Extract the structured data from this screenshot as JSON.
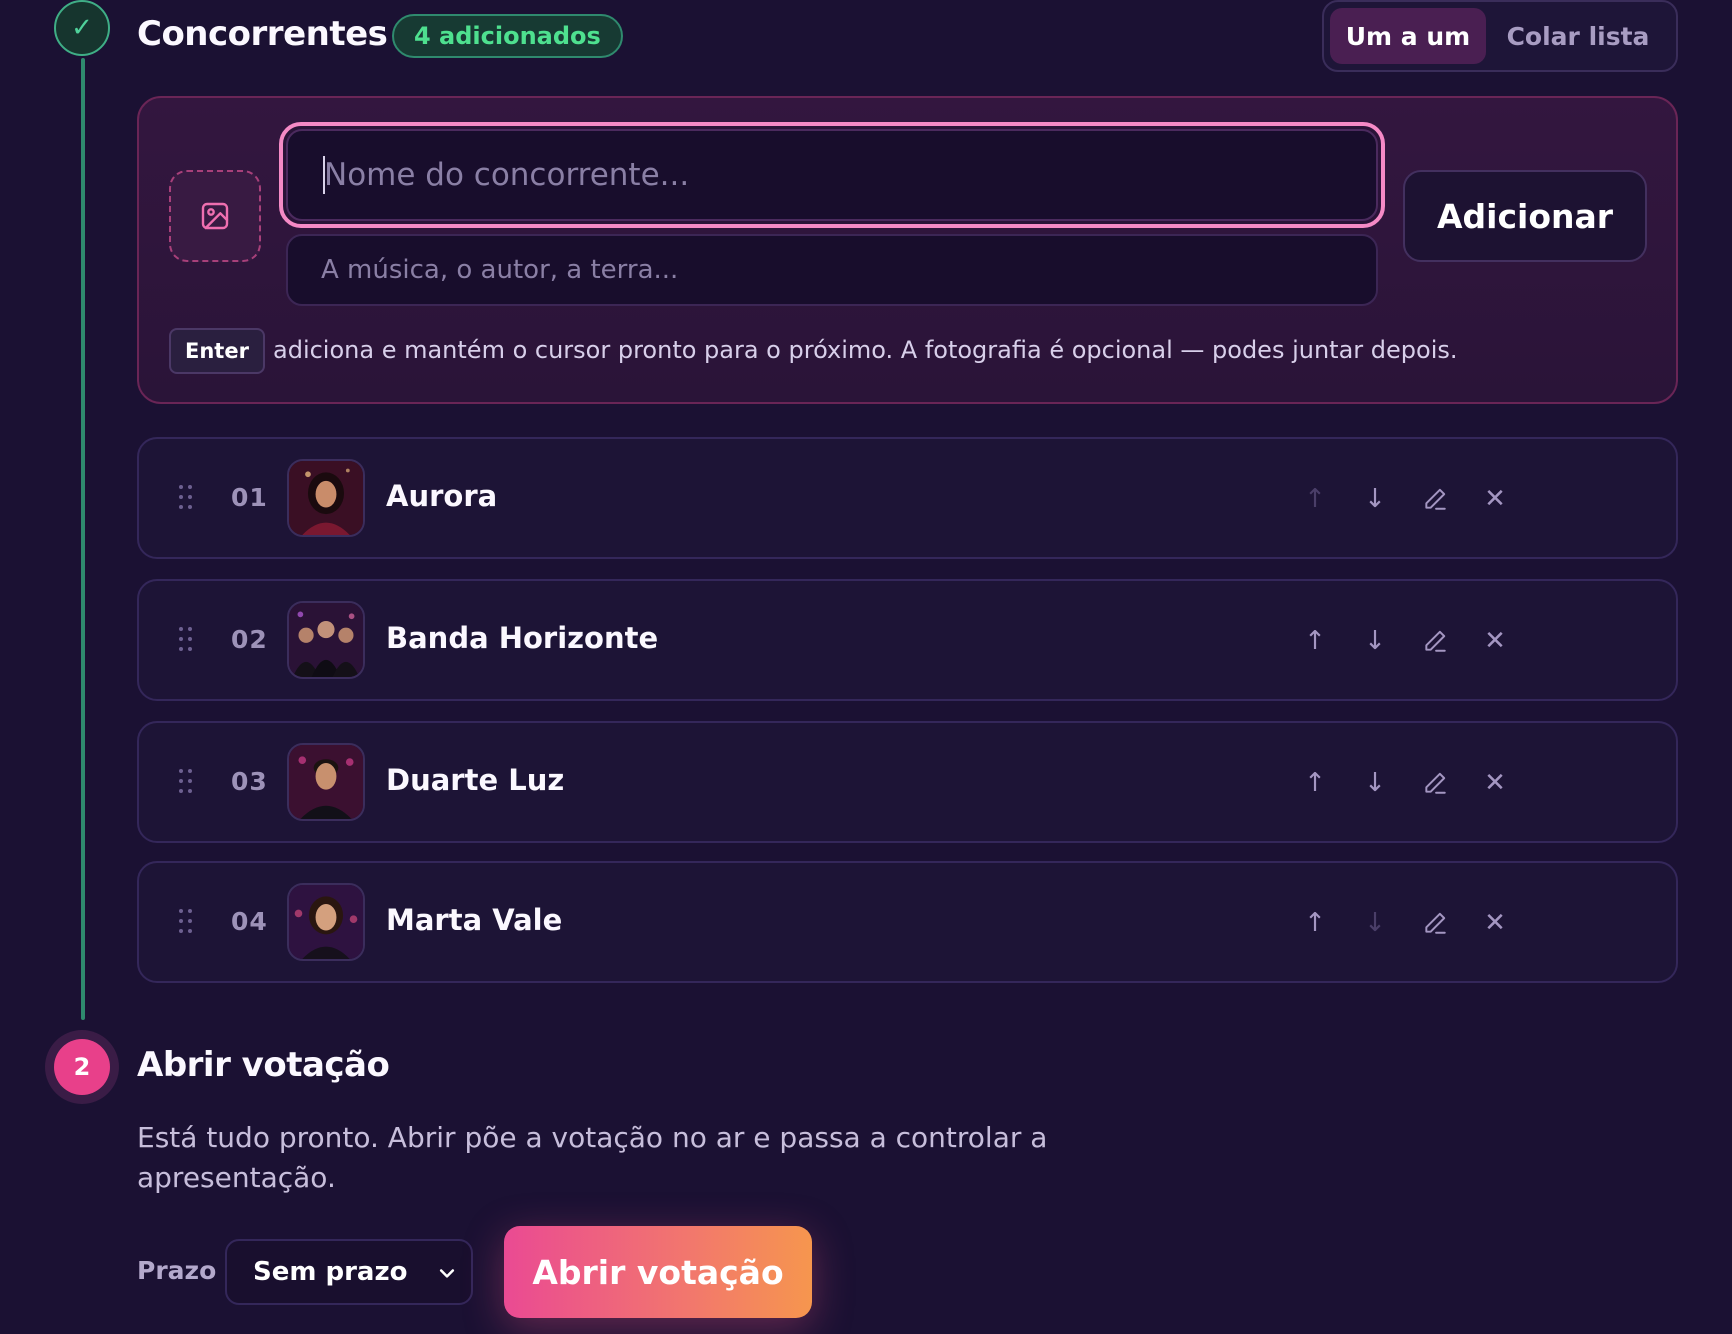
{
  "step1": {
    "check_glyph": "✓",
    "title": "Concorrentes",
    "count_badge": "4 adicionados",
    "mode_toggle": {
      "one_by_one": "Um a um",
      "paste_list": "Colar lista",
      "selected": "Um a um"
    },
    "add_form": {
      "name_placeholder": "Nome do concorrente...",
      "desc_placeholder": "A música, o autor, a terra...",
      "add_button": "Adicionar",
      "enter_key": "Enter",
      "hint": "adiciona e mantém o cursor pronto para o próximo. A fotografia é opcional — podes juntar depois."
    },
    "contestants": [
      {
        "number": "01",
        "name": "Aurora",
        "move_up_enabled": false,
        "move_down_enabled": true
      },
      {
        "number": "02",
        "name": "Banda Horizonte",
        "move_up_enabled": true,
        "move_down_enabled": true
      },
      {
        "number": "03",
        "name": "Duarte Luz",
        "move_up_enabled": true,
        "move_down_enabled": true
      },
      {
        "number": "04",
        "name": "Marta Vale",
        "move_up_enabled": true,
        "move_down_enabled": false
      }
    ],
    "row_action_icons": [
      "arrow-up-icon",
      "arrow-down-icon",
      "pencil-icon",
      "close-icon"
    ]
  },
  "step2": {
    "number": "2",
    "title": "Abrir votação",
    "description": "Está tudo pronto. Abrir põe a votação no ar e passa a controlar a apresentação.",
    "deadline_label": "Prazo",
    "deadline_value": "Sem prazo",
    "open_button": "Abrir votação"
  },
  "colors": {
    "background": "#1b1133",
    "accent_pink": "#ea4a93",
    "accent_orange": "#f6964e",
    "success_green": "#4ee08f",
    "focus_ring": "#f58ac6"
  }
}
